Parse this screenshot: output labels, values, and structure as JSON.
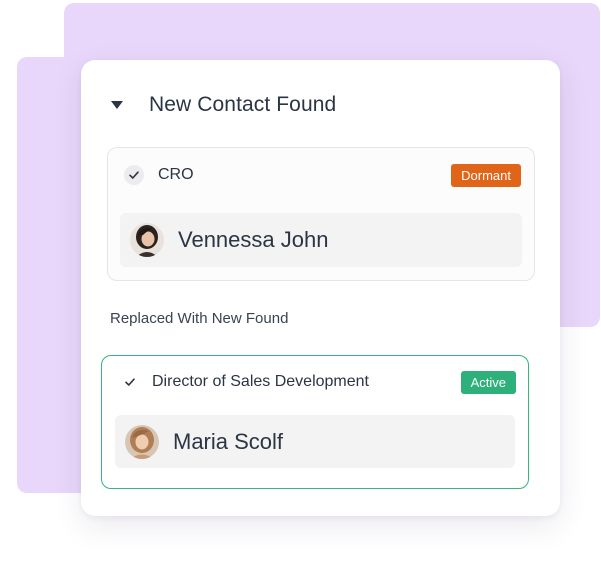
{
  "header": {
    "title": "New Contact Found",
    "caret_icon": "caret-down-icon"
  },
  "old_contact": {
    "role": "CRO",
    "status": "Dormant",
    "status_color": "#e16519",
    "name": "Vennessa John"
  },
  "replaced_label": "Replaced With New Found",
  "new_contact": {
    "role": "Director of Sales Development",
    "status": "Active",
    "status_color": "#2db07a",
    "name": "Maria Scolf"
  },
  "colors": {
    "backdrop": "#e8d7fa",
    "accent_green": "#36b37e",
    "text": "#2b3543"
  }
}
